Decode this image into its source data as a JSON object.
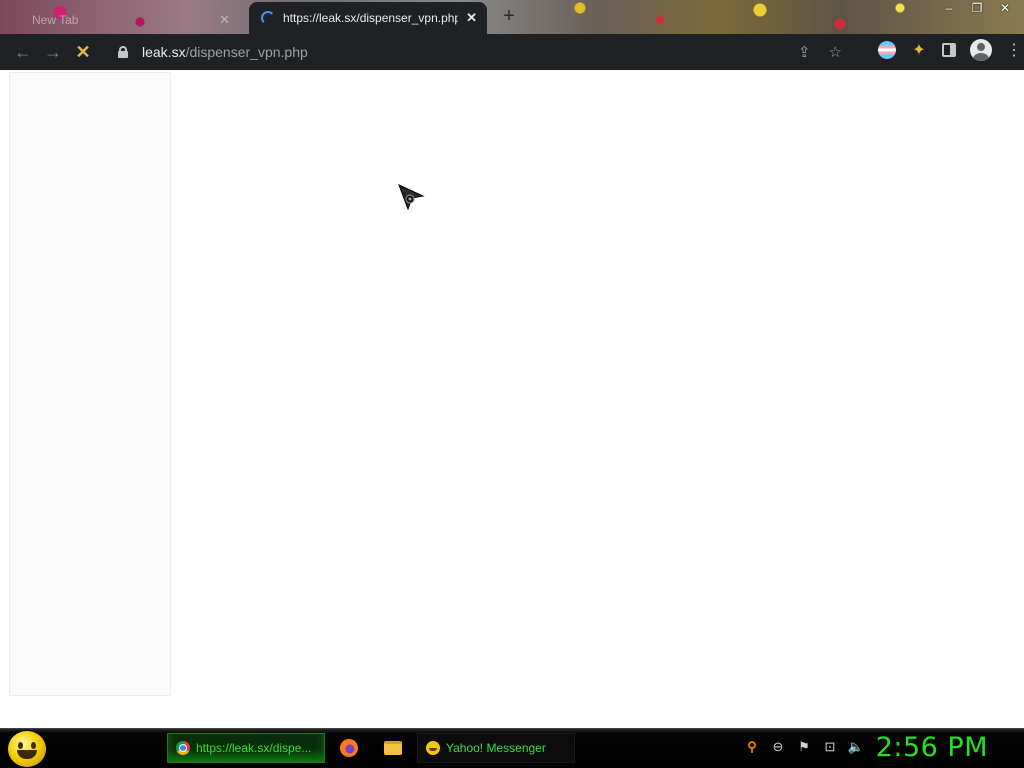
{
  "browser": {
    "tabs": [
      {
        "title": "New Tab",
        "active": false
      },
      {
        "title": "https://leak.sx/dispenser_vpn.php",
        "active": true,
        "loading": true
      }
    ],
    "new_tab_icon": "+",
    "window_controls": {
      "minimize": "–",
      "restore": "❐",
      "close": "✕"
    },
    "nav": {
      "back_icon": "←",
      "forward_icon": "→",
      "stop_icon": "✕"
    },
    "address": {
      "host": "leak.sx",
      "path": "/dispenser_vpn.php"
    },
    "omnibox_icons": {
      "share": "⇪",
      "bookmark": "☆"
    },
    "extensions_icon": "✦",
    "menu_icon": "⋮"
  },
  "taskbar": {
    "windows": [
      {
        "label": "https://leak.sx/dispe...",
        "icon": "chrome-icon",
        "active": true
      },
      {
        "label": "Yahoo! Messenger",
        "icon": "yahoo-messenger-icon",
        "active": false
      }
    ],
    "tray_icons": [
      "search",
      "messenger-status",
      "action-center-flag",
      "network",
      "volume"
    ],
    "tray_glyphs": {
      "search": "⚲",
      "status": "⊖",
      "flag": "⚑",
      "network": "⊡",
      "volume": "🔈"
    },
    "clock": "2:56 PM"
  }
}
